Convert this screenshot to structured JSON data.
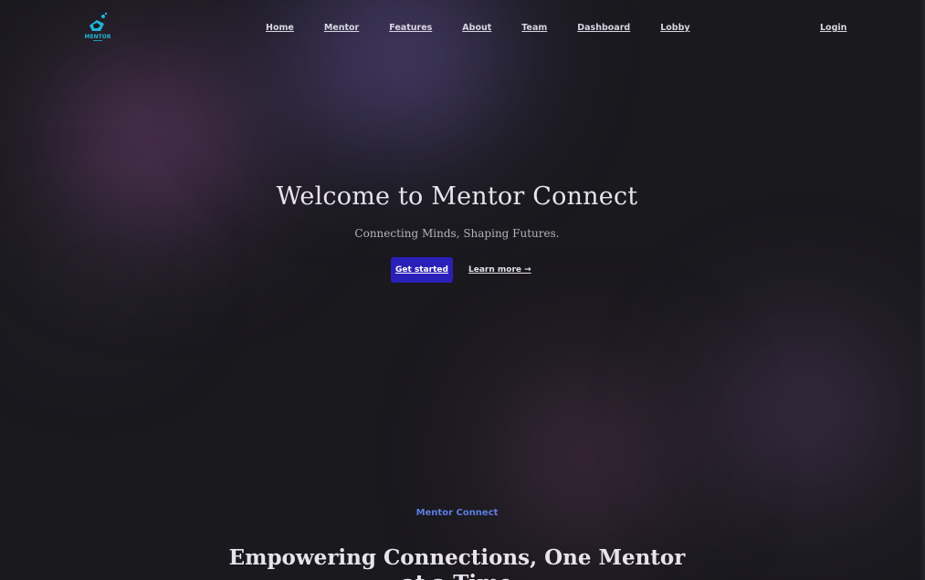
{
  "brand": {
    "logo_text": "MENTOR",
    "logo_color": "#1fb6d6"
  },
  "nav": {
    "links": [
      {
        "label": "Home"
      },
      {
        "label": "Mentor"
      },
      {
        "label": "Features"
      },
      {
        "label": "About"
      },
      {
        "label": "Team"
      },
      {
        "label": "Dashboard"
      },
      {
        "label": "Lobby"
      }
    ],
    "login_label": "Login"
  },
  "hero": {
    "title": "Welcome to Mentor Connect",
    "subtitle": "Connecting Minds, Shaping Futures.",
    "primary_cta": "Get started",
    "secondary_cta": "Learn more →"
  },
  "section": {
    "kicker": "Mentor Connect",
    "title_line1": "Empowering Connections, One Mentor",
    "title_line2": "at a Time"
  },
  "colors": {
    "background": "#1a191e",
    "accent": "#2a1fb8",
    "kicker": "#5b7ee0"
  }
}
